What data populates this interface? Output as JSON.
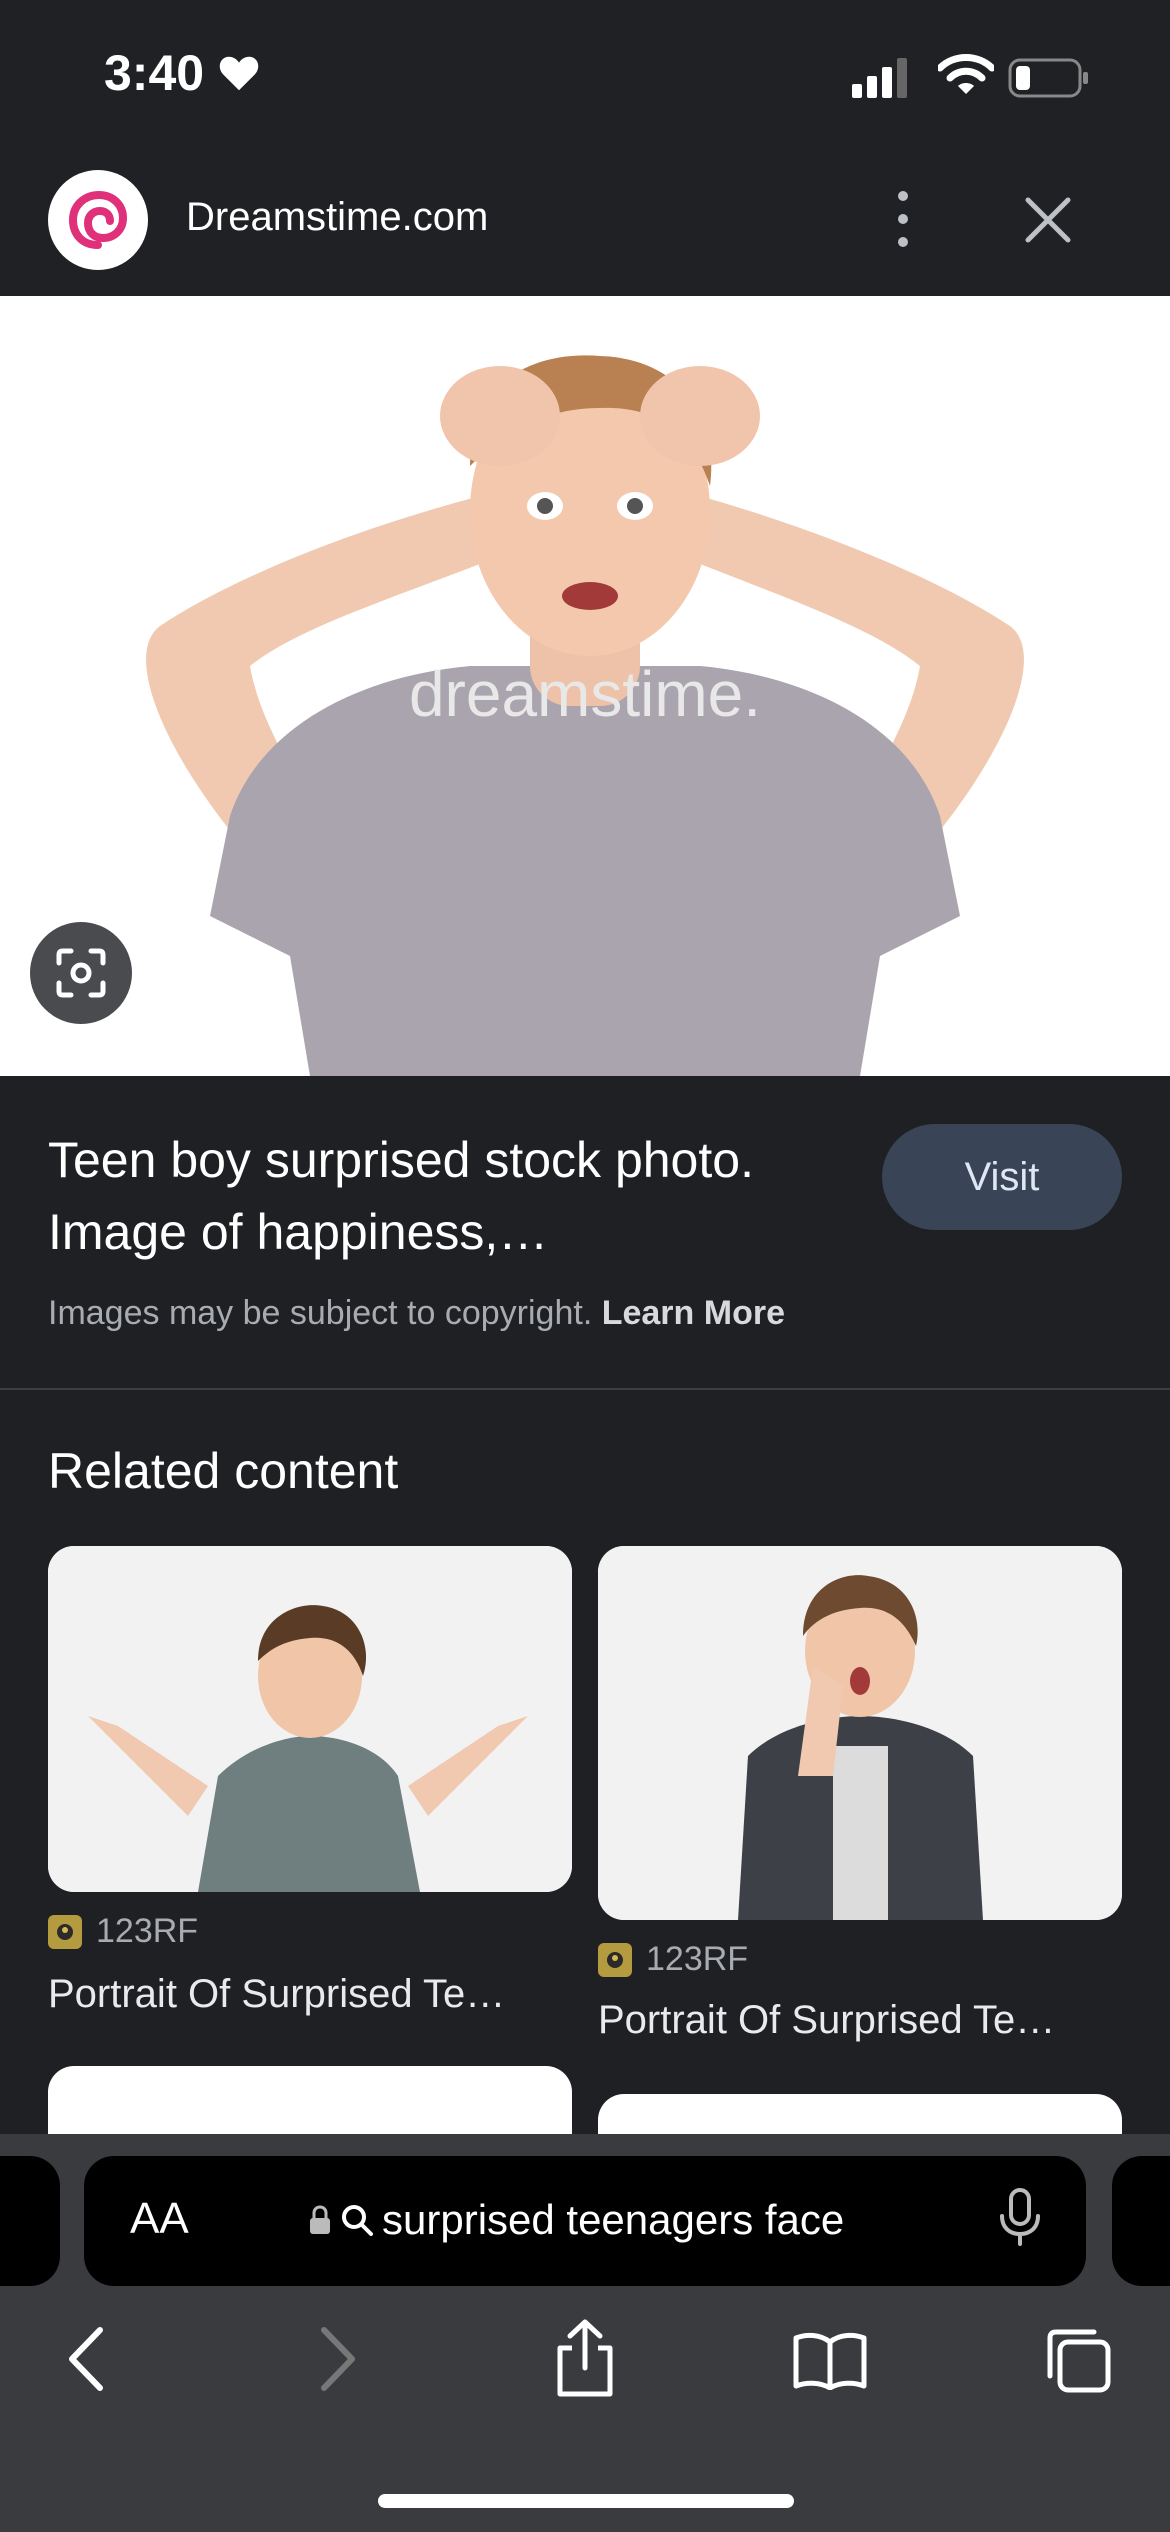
{
  "status_bar": {
    "time": "3:40"
  },
  "header": {
    "site_name": "Dreamstime.com"
  },
  "hero": {
    "watermark": "dreamstime."
  },
  "result": {
    "title": "Teen boy surprised stock photo. Image of happiness,…",
    "visit_label": "Visit",
    "copyright_text": "Images may be subject to copyright.",
    "learn_more": "Learn More"
  },
  "related": {
    "heading": "Related content",
    "items": [
      {
        "source": "123RF",
        "title": "Portrait Of Surprised Te…"
      },
      {
        "source": "123RF",
        "title": "Portrait Of Surprised Te…"
      }
    ]
  },
  "browser": {
    "text_size_label": "AA",
    "address_text": "surprised teenagers face"
  },
  "colors": {
    "background": "#1f2023",
    "visit_button": "#394457",
    "toolbar": "#3a3b3e",
    "brand_logo": "#e0307a"
  }
}
